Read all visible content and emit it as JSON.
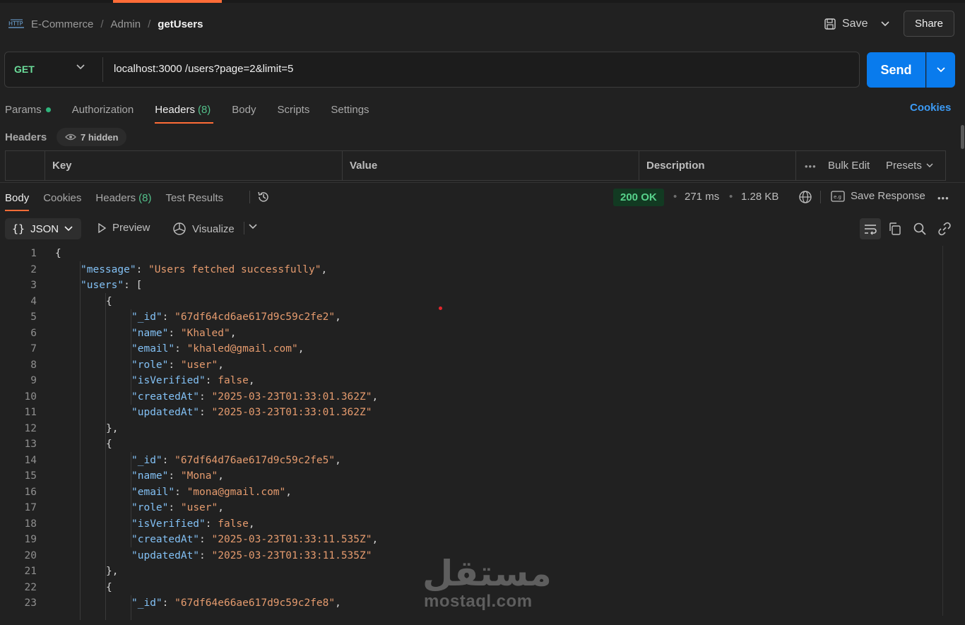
{
  "breadcrumb": {
    "items": [
      "E-Commerce",
      "Admin"
    ],
    "separator": "/",
    "current": "getUsers"
  },
  "header": {
    "save_label": "Save",
    "share_label": "Share"
  },
  "request": {
    "method": "GET",
    "url": "localhost:3000 /users?page=2&limit=5",
    "send_label": "Send"
  },
  "request_tabs": {
    "params": "Params",
    "authorization": "Authorization",
    "headers": "Headers",
    "headers_count": "(8)",
    "body": "Body",
    "scripts": "Scripts",
    "settings": "Settings",
    "cookies": "Cookies"
  },
  "headers_panel": {
    "title": "Headers",
    "hidden_label": "7 hidden",
    "columns": [
      "Key",
      "Value",
      "Description"
    ],
    "bulk_edit": "Bulk Edit",
    "presets": "Presets"
  },
  "response_tabs": {
    "body": "Body",
    "cookies": "Cookies",
    "headers": "Headers",
    "headers_count": "(8)",
    "test_results": "Test Results"
  },
  "response_meta": {
    "status": "200 OK",
    "time": "271 ms",
    "size": "1.28 KB",
    "save_response": "Save Response"
  },
  "body_toolbar": {
    "format": "JSON",
    "preview": "Preview",
    "visualize": "Visualize"
  },
  "code_lines": [
    {
      "n": "1",
      "indent": 0,
      "tokens": [
        [
          "p",
          "{"
        ]
      ]
    },
    {
      "n": "2",
      "indent": 1,
      "tokens": [
        [
          "k",
          "\"message\""
        ],
        [
          "p",
          ": "
        ],
        [
          "s",
          "\"Users fetched successfully\""
        ],
        [
          "p",
          ","
        ]
      ]
    },
    {
      "n": "3",
      "indent": 1,
      "tokens": [
        [
          "k",
          "\"users\""
        ],
        [
          "p",
          ": ["
        ]
      ]
    },
    {
      "n": "4",
      "indent": 2,
      "tokens": [
        [
          "p",
          "{"
        ]
      ]
    },
    {
      "n": "5",
      "indent": 3,
      "tokens": [
        [
          "k",
          "\"_id\""
        ],
        [
          "p",
          ": "
        ],
        [
          "s",
          "\"67df64cd6ae617d9c59c2fe2\""
        ],
        [
          "p",
          ","
        ]
      ]
    },
    {
      "n": "6",
      "indent": 3,
      "tokens": [
        [
          "k",
          "\"name\""
        ],
        [
          "p",
          ": "
        ],
        [
          "s",
          "\"Khaled\""
        ],
        [
          "p",
          ","
        ]
      ]
    },
    {
      "n": "7",
      "indent": 3,
      "tokens": [
        [
          "k",
          "\"email\""
        ],
        [
          "p",
          ": "
        ],
        [
          "s",
          "\"khaled@gmail.com\""
        ],
        [
          "p",
          ","
        ]
      ]
    },
    {
      "n": "8",
      "indent": 3,
      "tokens": [
        [
          "k",
          "\"role\""
        ],
        [
          "p",
          ": "
        ],
        [
          "s",
          "\"user\""
        ],
        [
          "p",
          ","
        ]
      ]
    },
    {
      "n": "9",
      "indent": 3,
      "tokens": [
        [
          "k",
          "\"isVerified\""
        ],
        [
          "p",
          ": "
        ],
        [
          "b",
          "false"
        ],
        [
          "p",
          ","
        ]
      ]
    },
    {
      "n": "10",
      "indent": 3,
      "tokens": [
        [
          "k",
          "\"createdAt\""
        ],
        [
          "p",
          ": "
        ],
        [
          "s",
          "\"2025-03-23T01:33:01.362Z\""
        ],
        [
          "p",
          ","
        ]
      ]
    },
    {
      "n": "11",
      "indent": 3,
      "tokens": [
        [
          "k",
          "\"updatedAt\""
        ],
        [
          "p",
          ": "
        ],
        [
          "s",
          "\"2025-03-23T01:33:01.362Z\""
        ]
      ]
    },
    {
      "n": "12",
      "indent": 2,
      "tokens": [
        [
          "p",
          "},"
        ]
      ]
    },
    {
      "n": "13",
      "indent": 2,
      "tokens": [
        [
          "p",
          "{"
        ]
      ]
    },
    {
      "n": "14",
      "indent": 3,
      "tokens": [
        [
          "k",
          "\"_id\""
        ],
        [
          "p",
          ": "
        ],
        [
          "s",
          "\"67df64d76ae617d9c59c2fe5\""
        ],
        [
          "p",
          ","
        ]
      ]
    },
    {
      "n": "15",
      "indent": 3,
      "tokens": [
        [
          "k",
          "\"name\""
        ],
        [
          "p",
          ": "
        ],
        [
          "s",
          "\"Mona\""
        ],
        [
          "p",
          ","
        ]
      ]
    },
    {
      "n": "16",
      "indent": 3,
      "tokens": [
        [
          "k",
          "\"email\""
        ],
        [
          "p",
          ": "
        ],
        [
          "s",
          "\"mona@gmail.com\""
        ],
        [
          "p",
          ","
        ]
      ]
    },
    {
      "n": "17",
      "indent": 3,
      "tokens": [
        [
          "k",
          "\"role\""
        ],
        [
          "p",
          ": "
        ],
        [
          "s",
          "\"user\""
        ],
        [
          "p",
          ","
        ]
      ]
    },
    {
      "n": "18",
      "indent": 3,
      "tokens": [
        [
          "k",
          "\"isVerified\""
        ],
        [
          "p",
          ": "
        ],
        [
          "b",
          "false"
        ],
        [
          "p",
          ","
        ]
      ]
    },
    {
      "n": "19",
      "indent": 3,
      "tokens": [
        [
          "k",
          "\"createdAt\""
        ],
        [
          "p",
          ": "
        ],
        [
          "s",
          "\"2025-03-23T01:33:11.535Z\""
        ],
        [
          "p",
          ","
        ]
      ]
    },
    {
      "n": "20",
      "indent": 3,
      "tokens": [
        [
          "k",
          "\"updatedAt\""
        ],
        [
          "p",
          ": "
        ],
        [
          "s",
          "\"2025-03-23T01:33:11.535Z\""
        ]
      ]
    },
    {
      "n": "21",
      "indent": 2,
      "tokens": [
        [
          "p",
          "},"
        ]
      ]
    },
    {
      "n": "22",
      "indent": 2,
      "tokens": [
        [
          "p",
          "{"
        ]
      ]
    },
    {
      "n": "23",
      "indent": 3,
      "tokens": [
        [
          "k",
          "\"_id\""
        ],
        [
          "p",
          ": "
        ],
        [
          "s",
          "\"67df64e66ae617d9c59c2fe8\""
        ],
        [
          "p",
          ","
        ]
      ]
    }
  ],
  "watermark": {
    "arabic": "مستقل",
    "latin": "mostaql.com"
  },
  "colors": {
    "accent": "#ff6c37",
    "send": "#097bed",
    "method_get": "#6bdd9a",
    "json_key": "#83c1f5",
    "json_string": "#e59b6e",
    "status_ok": "#57d28b"
  },
  "icons": [
    "http-icon",
    "save-icon",
    "chevron-down-icon",
    "history-icon",
    "globe-icon",
    "save-response-icon",
    "more-icon",
    "play-icon",
    "visualize-icon",
    "wrap-icon",
    "copy-icon",
    "search-icon",
    "link-icon",
    "eye-icon"
  ]
}
